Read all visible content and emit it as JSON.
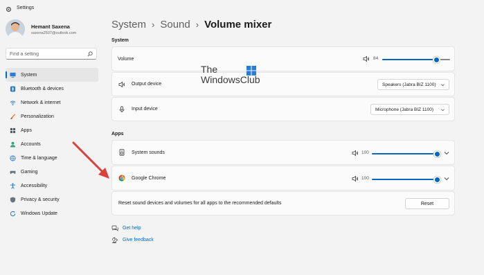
{
  "window": {
    "title": "Settings"
  },
  "user": {
    "name": "Hemant Saxena",
    "email": "saxena2507@outlook.com"
  },
  "search": {
    "placeholder": "Find a setting"
  },
  "nav": [
    {
      "label": "System",
      "icon": "monitor-icon",
      "active": true
    },
    {
      "label": "Bluetooth & devices",
      "icon": "bluetooth-icon"
    },
    {
      "label": "Network & internet",
      "icon": "wifi-icon"
    },
    {
      "label": "Personalization",
      "icon": "brush-icon"
    },
    {
      "label": "Apps",
      "icon": "apps-icon"
    },
    {
      "label": "Accounts",
      "icon": "person-icon"
    },
    {
      "label": "Time & language",
      "icon": "globe-clock-icon"
    },
    {
      "label": "Gaming",
      "icon": "controller-icon"
    },
    {
      "label": "Accessibility",
      "icon": "accessibility-icon"
    },
    {
      "label": "Privacy & security",
      "icon": "shield-icon"
    },
    {
      "label": "Windows Update",
      "icon": "update-icon"
    }
  ],
  "breadcrumb": {
    "part1": "System",
    "part2": "Sound",
    "current": "Volume mixer",
    "separator": "›"
  },
  "system_section": {
    "label": "System",
    "volume": {
      "label": "Volume",
      "value": "84",
      "level": 0.84
    },
    "output": {
      "label": "Output device",
      "selected": "Speakers (Jabra BIZ 1100)"
    },
    "input": {
      "label": "Input device",
      "selected": "Microphone (Jabra BIZ 1100)"
    }
  },
  "apps_section": {
    "label": "Apps",
    "apps": [
      {
        "name": "System sounds",
        "value": "100",
        "level": 1.0
      },
      {
        "name": "Google Chrome",
        "value": "100",
        "level": 1.0
      }
    ],
    "reset_text": "Reset sound devices and volumes for all apps to the recommended defaults",
    "reset_button": "Reset"
  },
  "links": {
    "help": "Get help",
    "feedback": "Give feedback"
  },
  "watermark": {
    "line1": "The",
    "line2": "WindowsClub"
  },
  "colors": {
    "accent": "#0067c0",
    "annotation_arrow": "#d9423a"
  }
}
